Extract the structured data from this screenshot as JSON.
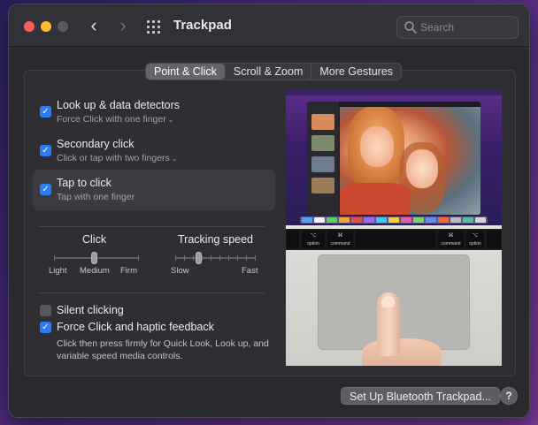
{
  "window": {
    "title": "Trackpad",
    "back_icon": "‹",
    "forward_icon": "›"
  },
  "search": {
    "placeholder": "Search",
    "value": ""
  },
  "tabs": [
    {
      "label": "Point & Click",
      "active": true
    },
    {
      "label": "Scroll & Zoom",
      "active": false
    },
    {
      "label": "More Gestures",
      "active": false
    }
  ],
  "options": {
    "lookup": {
      "title": "Look up & data detectors",
      "sub": "Force Click with one finger",
      "checked": true
    },
    "secondary": {
      "title": "Secondary click",
      "sub": "Click or tap with two fingers",
      "checked": true
    },
    "tap": {
      "title": "Tap to click",
      "sub": "Tap with one finger",
      "checked": true
    }
  },
  "click_slider": {
    "label": "Click",
    "ticks": [
      "Light",
      "Medium",
      "Firm"
    ],
    "value_index": 1
  },
  "tracking_slider": {
    "label": "Tracking speed",
    "min_label": "Slow",
    "max_label": "Fast",
    "level": 0.3
  },
  "silent": {
    "label": "Silent clicking",
    "checked": false
  },
  "force": {
    "label": "Force Click and haptic feedback",
    "checked": true,
    "description": "Click then press firmly for Quick Look, Look up, and variable speed media controls."
  },
  "keyboard": {
    "option_symbol": "⌥",
    "option_label": "option",
    "command_symbol": "⌘",
    "command_label": "command"
  },
  "footer": {
    "bt_button": "Set Up Bluetooth Trackpad...",
    "help": "?"
  },
  "colors": {
    "accent": "#2b7cf7",
    "close": "#fe5f57",
    "minimize": "#febc2e"
  }
}
